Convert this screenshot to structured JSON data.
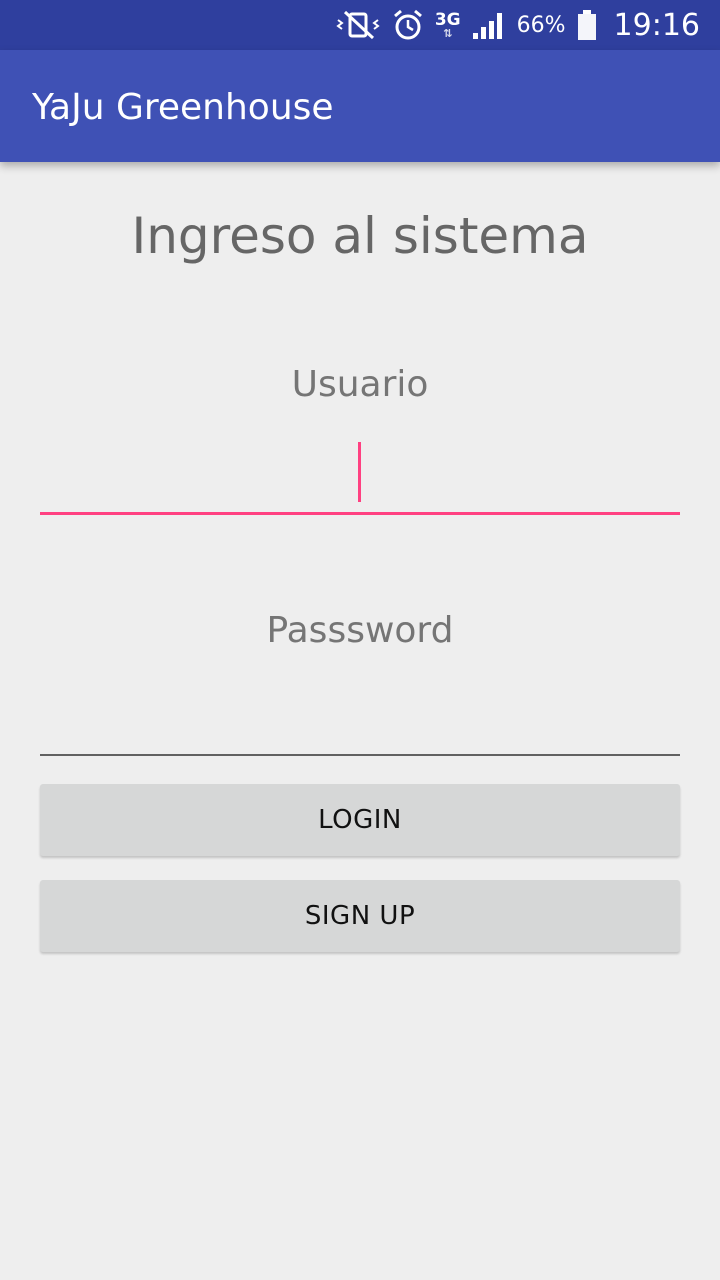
{
  "status_bar": {
    "network_type": "3G",
    "network_arrows": "⇅",
    "battery_percent": "66%",
    "time": "19:16",
    "icons": [
      "vibrate-mute-icon",
      "alarm-icon",
      "network-3g-icon",
      "signal-icon",
      "battery-icon"
    ]
  },
  "app_bar": {
    "title": "YaJu Greenhouse"
  },
  "login": {
    "heading": "Ingreso al sistema",
    "username_label": "Usuario",
    "username_value": "",
    "password_label": "Passsword",
    "password_value": "",
    "login_button": "LOGIN",
    "signup_button": "SIGN UP"
  },
  "colors": {
    "status_bar": "#2f3f9e",
    "app_bar": "#3f51b5",
    "accent": "#ff4081",
    "background": "#eeeeee",
    "button": "#d6d7d7"
  }
}
